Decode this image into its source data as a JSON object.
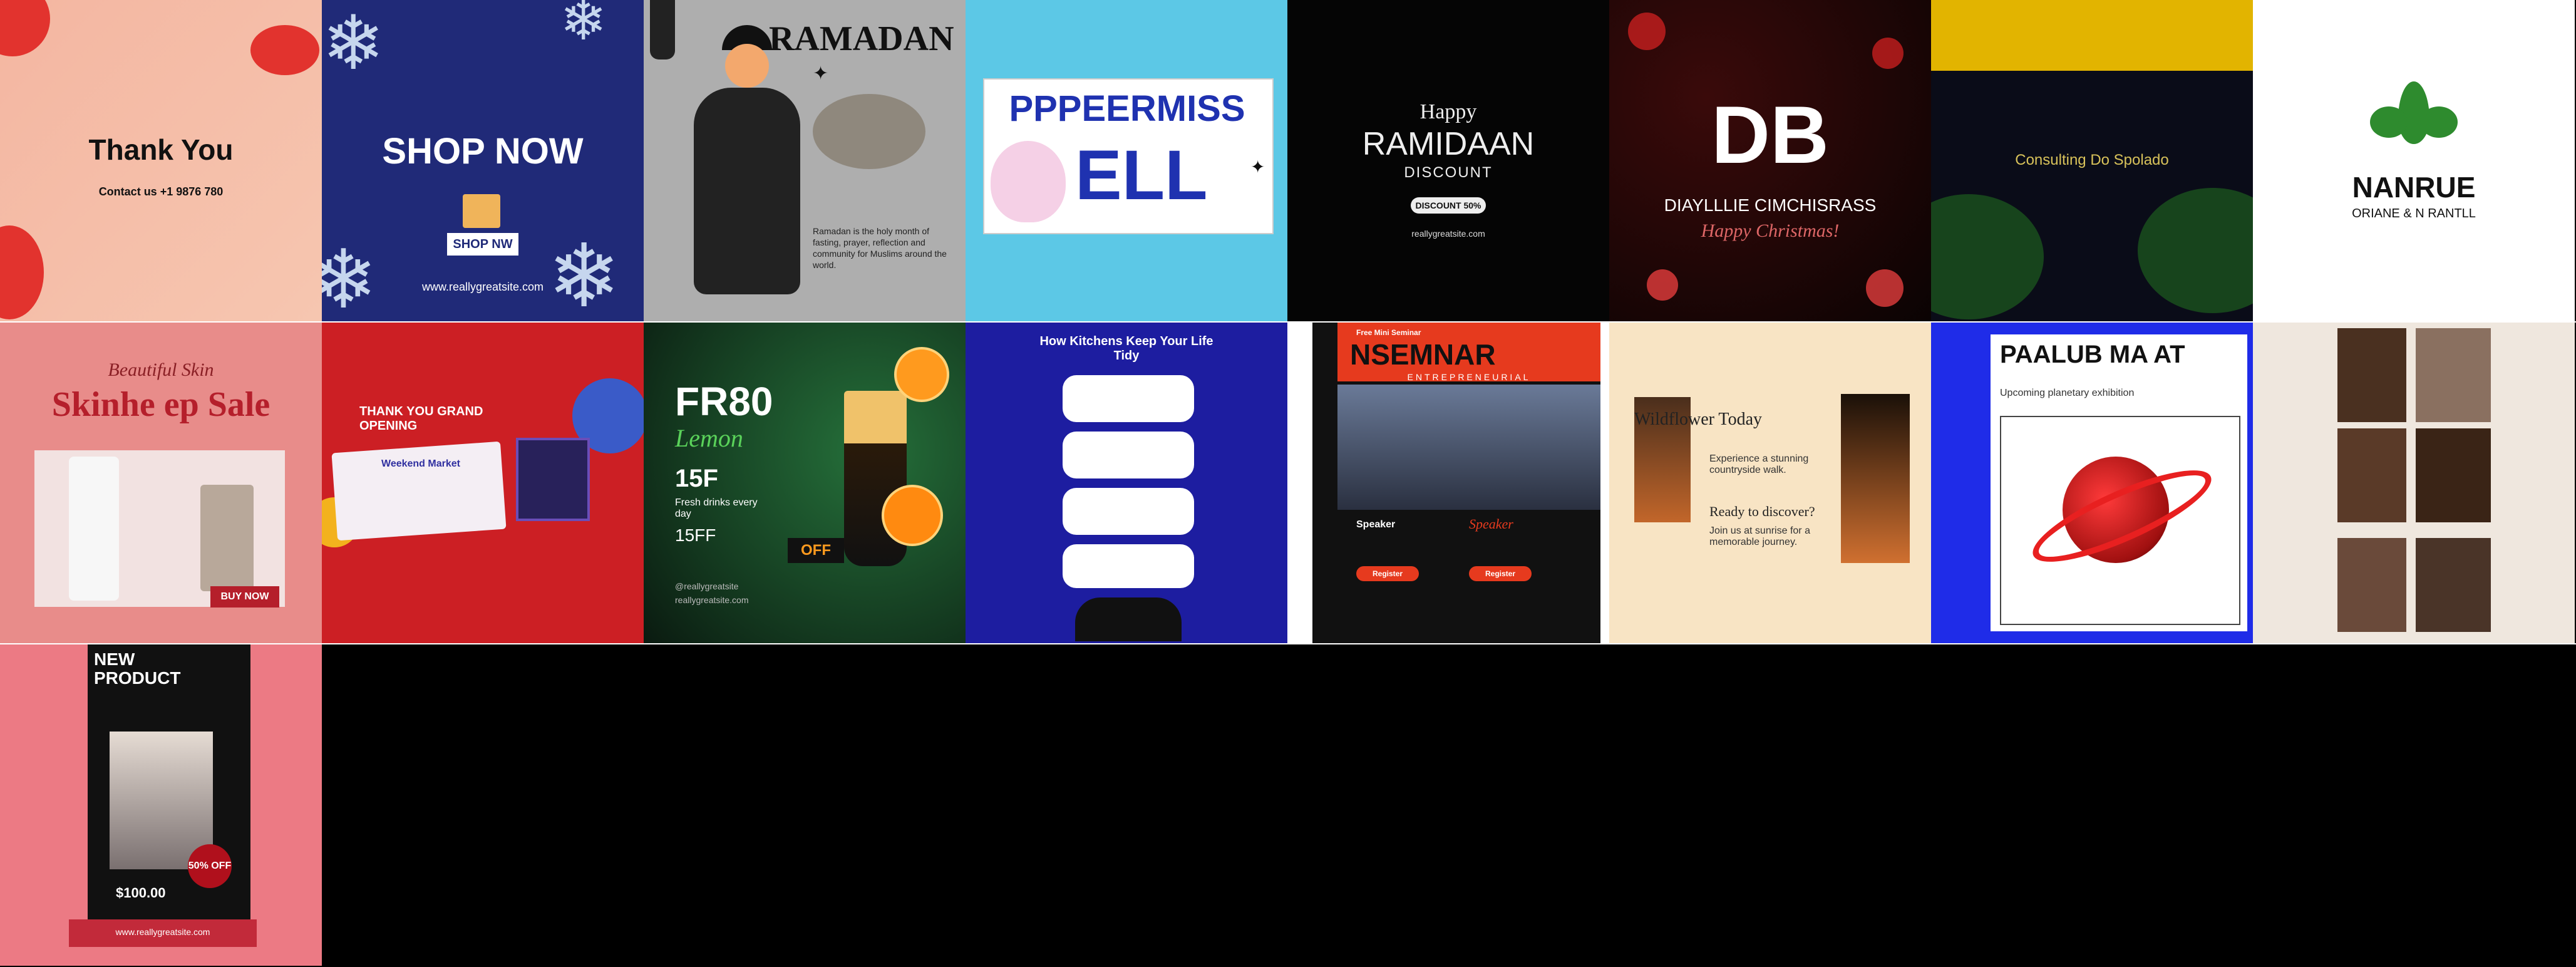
{
  "tiles": {
    "t1": {
      "title": "Thank You",
      "contact": "Contact us +1 9876 780"
    },
    "t2": {
      "title": "SHOP NOW",
      "button": "SHOP NW",
      "site": "www.reallygreatsite.com"
    },
    "t3": {
      "title": "RAMADAN",
      "body": "Ramadan is the holy month of fasting, prayer, reflection and community for Muslims around the world."
    },
    "t4": {
      "line1": "PPPEERMISS",
      "line2": "ELL"
    },
    "t5": {
      "happy": "Happy",
      "title": "RAMIDAAN",
      "sub": "DISCOUNT",
      "badge": "DISCOUNT 50%",
      "site": "reallygreatsite.com"
    },
    "t6": {
      "big": "DB",
      "line1": "DIAYLLLIE CIMCHISRASS",
      "line2": "Happy Christmas!"
    },
    "t7": {
      "text": "Consulting Do Spolado"
    },
    "t8": {
      "brand": "NANRUE",
      "sub": "ORIANE & N RANTLL"
    },
    "t9": {
      "script": "Beautiful Skin",
      "title": "Skinhe ep Sale",
      "button": "BUY NOW"
    },
    "t10": {
      "title": "THANK YOU GRAND OPENING",
      "card": "Weekend Market"
    },
    "t11": {
      "big": "FR80",
      "script": "Lemon",
      "price": "15F",
      "desc": "Fresh drinks every day",
      "offer": "15FF",
      "badge": "OFF",
      "site1": "@reallygreatsite",
      "site2": "reallygreatsite.com"
    },
    "t12": {
      "title": "How Kitchens Keep Your Life Tidy"
    },
    "t13": {
      "label": "Free Mini Seminar",
      "title": "NSEMNAR",
      "sub": "ENTREPRENEURIAL",
      "name1": "Speaker",
      "name2": "Speaker",
      "btn1": "Register",
      "btn2": "Register"
    },
    "t14": {
      "title": "Wildflower Today",
      "p1": "Experience a stunning countryside walk.",
      "q": "Ready to discover?",
      "p2": "Join us at sunrise for a memorable journey."
    },
    "t15": {
      "title": "PAALUB MA AT",
      "sub": "Upcoming planetary exhibition"
    },
    "t16": {
      "caption": ""
    },
    "t17": {
      "title": "NEW PRODUCT",
      "discount": "50% OFF",
      "price": "$100.00",
      "site": "www.reallygreatsite.com"
    }
  }
}
